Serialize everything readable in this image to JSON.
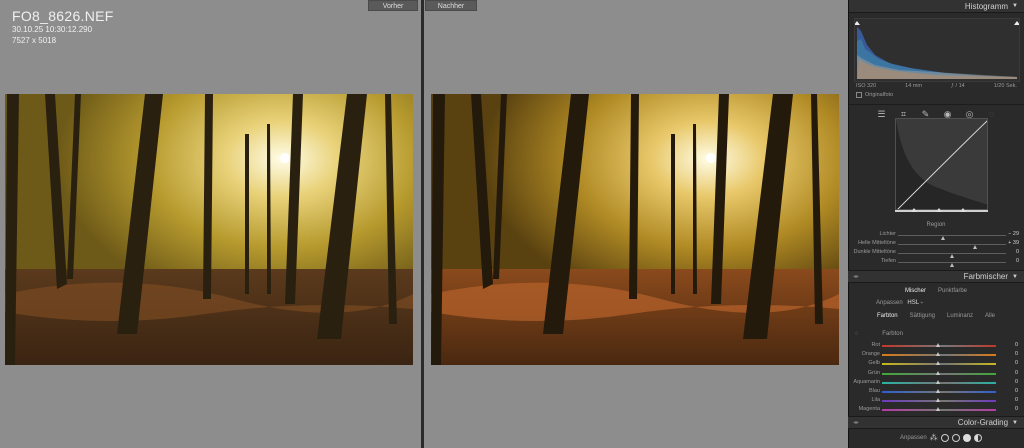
{
  "file": {
    "name": "FO8_8626.NEF",
    "datetime": "30.10.25 10:30:12.290",
    "dimensions": "7527 x 5018"
  },
  "view_tabs": {
    "before": "Vorher",
    "after": "Nachher"
  },
  "histogram": {
    "title": "Histogramm",
    "iso": "ISO 320",
    "focal": "14 mm",
    "aperture": "ƒ / 14",
    "shutter": "1/20 Sek.",
    "original_label": "Originalfoto"
  },
  "tools": [
    "sliders-icon",
    "crop-icon",
    "heal-icon",
    "mask-icon",
    "redeye-icon",
    "preset-icon"
  ],
  "tone_curve": {
    "region_title": "Region",
    "sliders": [
      {
        "label": "Lichter",
        "value": "− 29",
        "pos": 0.42
      },
      {
        "label": "Helle Mitteltöne",
        "value": "+ 39",
        "pos": 0.72
      },
      {
        "label": "Dunkle Mitteltöne",
        "value": "0",
        "pos": 0.5
      },
      {
        "label": "Tiefen",
        "value": "0",
        "pos": 0.5
      }
    ]
  },
  "color_mixer": {
    "title": "Farbmischer",
    "tabs": [
      "Mischer",
      "Punktfarbe"
    ],
    "adjust_label": "Anpassen",
    "adjust_value": "HSL",
    "subtabs": [
      "Farbton",
      "Sättigung",
      "Luminanz",
      "Alle"
    ],
    "section_label": "Farbton",
    "channels": [
      {
        "label": "Rot",
        "value": "0",
        "color": "#c0392b"
      },
      {
        "label": "Orange",
        "value": "0",
        "color": "#d97a1a"
      },
      {
        "label": "Gelb",
        "value": "0",
        "color": "#c9b81c"
      },
      {
        "label": "Grün",
        "value": "0",
        "color": "#3fa93a"
      },
      {
        "label": "Aquamarin",
        "value": "0",
        "color": "#27b3a4"
      },
      {
        "label": "Blau",
        "value": "0",
        "color": "#2f5fd0"
      },
      {
        "label": "Lila",
        "value": "0",
        "color": "#6d3bbd"
      },
      {
        "label": "Magenta",
        "value": "0",
        "color": "#b83aa6"
      }
    ]
  },
  "color_grading": {
    "title": "Color-Grading",
    "adjust_label": "Anpassen"
  }
}
